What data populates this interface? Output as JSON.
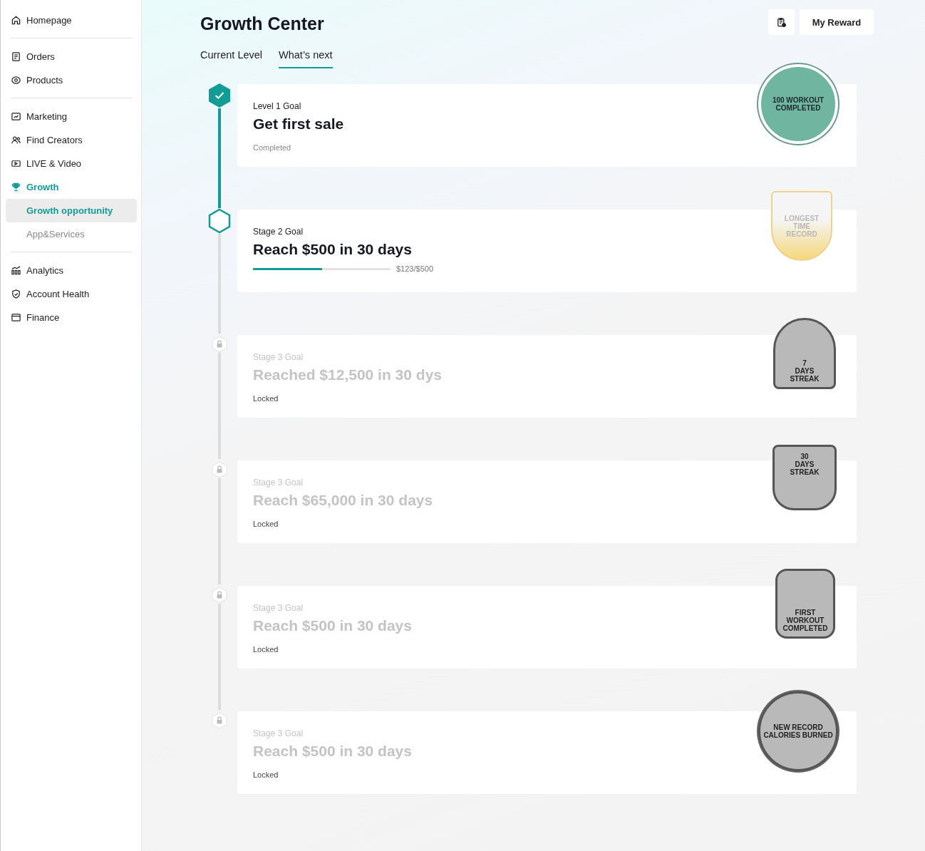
{
  "sidebar": {
    "groups": [
      {
        "items": [
          {
            "label": "Homepage"
          }
        ]
      },
      {
        "items": [
          {
            "label": "Orders"
          },
          {
            "label": "Products"
          }
        ]
      },
      {
        "items": [
          {
            "label": "Marketing"
          },
          {
            "label": "Find Creators"
          },
          {
            "label": "LIVE & Video"
          },
          {
            "label": "Growth",
            "active": true,
            "children": [
              {
                "label": "Growth opportunity",
                "selected": true
              },
              {
                "label": "App&Services",
                "selected": false
              }
            ]
          }
        ]
      },
      {
        "items": [
          {
            "label": "Analytics"
          },
          {
            "label": "Account Health"
          },
          {
            "label": "Finance"
          }
        ]
      }
    ]
  },
  "header": {
    "title": "Growth Center",
    "reward_button": "My Reward"
  },
  "tabs": [
    {
      "label": "Current Level",
      "selected": false
    },
    {
      "label": "What’s next",
      "selected": true
    }
  ],
  "goals": [
    {
      "kind": "completed",
      "stage": "Level 1 Goal",
      "title": "Get first sale",
      "status": "Completed",
      "badge": {
        "lines": [
          "100 WORKOUT",
          "COMPLETED"
        ]
      }
    },
    {
      "kind": "progress",
      "stage": "Stage 2 Goal",
      "title": "Reach $500 in 30 days",
      "level": 0.5,
      "reading": "$123/$500",
      "badge": {
        "lines": [
          "LONGEST",
          "TIME",
          "RECORD"
        ]
      }
    },
    {
      "kind": "locked",
      "stage": "Stage 3 Goal",
      "title": "Reached $12,500 in 30 dys",
      "status": "Locked",
      "badge": {
        "lines": [
          "7",
          "DAYS",
          "STREAK"
        ]
      }
    },
    {
      "kind": "locked",
      "stage": "Stage 3 Goal",
      "title": "Reach $65,000 in 30 days",
      "status": "Locked",
      "badge": {
        "lines": [
          "30",
          "DAYS",
          "STREAK"
        ]
      }
    },
    {
      "kind": "locked",
      "stage": "Stage 3 Goal",
      "title": "Reach $500 in 30 days",
      "status": "Locked",
      "badge": {
        "lines": [
          "FIRST",
          "WORKOUT",
          "COMPLETED"
        ]
      }
    },
    {
      "kind": "locked",
      "stage": "Stage 3 Goal",
      "title": "Reach $500 in 30 days",
      "status": "Locked",
      "badge": {
        "lines": [
          "NEW RECORD",
          "CALORIES BURNED"
        ]
      }
    }
  ]
}
